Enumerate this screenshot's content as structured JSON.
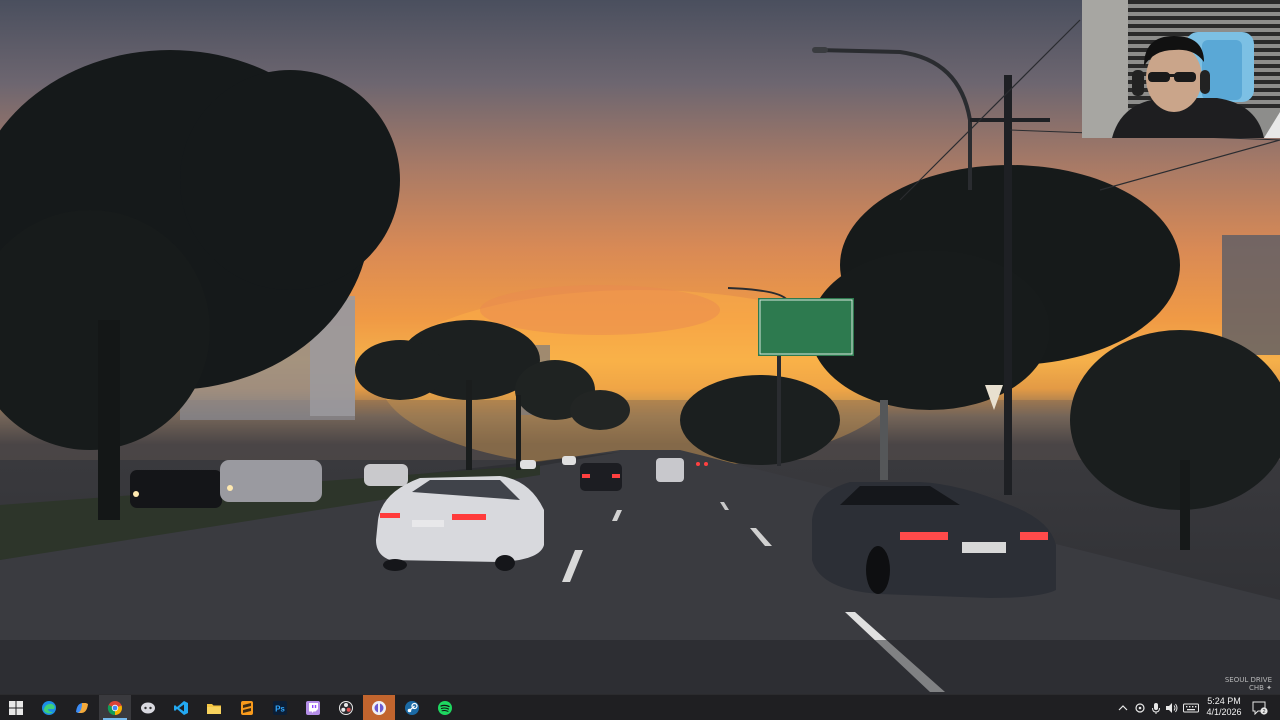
{
  "taskbar": {
    "apps": [
      {
        "name": "start-button",
        "icon": "windows-logo-icon"
      },
      {
        "name": "edge",
        "icon": "edge-icon"
      },
      {
        "name": "copilot",
        "icon": "copilot-icon"
      },
      {
        "name": "chrome",
        "icon": "chrome-icon",
        "active": true
      },
      {
        "name": "app-5",
        "icon": "chat-app-icon"
      },
      {
        "name": "vscode",
        "icon": "vscode-icon"
      },
      {
        "name": "file-explorer",
        "icon": "folder-icon"
      },
      {
        "name": "sublime-text",
        "icon": "sublime-icon"
      },
      {
        "name": "photoshop",
        "icon": "photoshop-icon"
      },
      {
        "name": "twitch",
        "icon": "twitch-icon"
      },
      {
        "name": "obs",
        "icon": "obs-icon"
      },
      {
        "name": "app-12",
        "icon": "orange-app-icon"
      },
      {
        "name": "steam",
        "icon": "steam-icon"
      },
      {
        "name": "spotify",
        "icon": "spotify-icon"
      }
    ],
    "photoshop_label": "Ps",
    "clock": {
      "time": "5:24 PM",
      "date": "4/1/2026"
    },
    "notification_count": "2"
  },
  "overlay": {
    "watermark_line1": "SEOUL DRIVE",
    "watermark_line2": "CHB ✦"
  },
  "colors": {
    "taskbar_bg": "#1f1f22",
    "active_indicator": "#76b9ed",
    "sky_top": "#4a4f5e",
    "sky_sunset": "#f5b04a"
  }
}
